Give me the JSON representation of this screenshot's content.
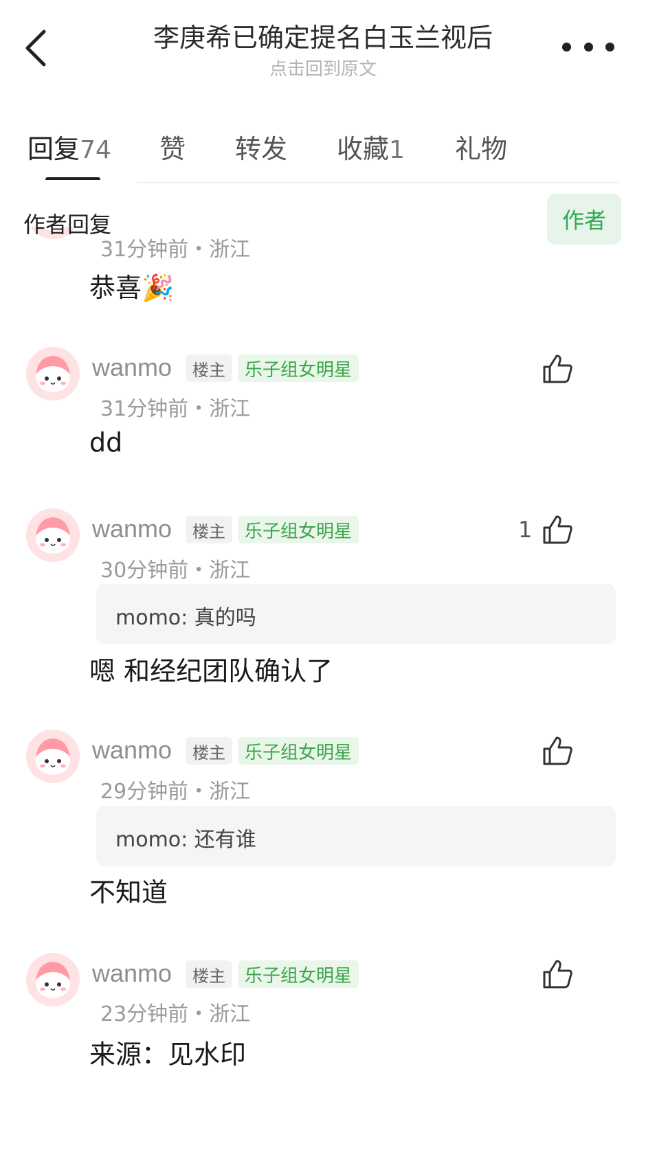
{
  "header": {
    "title": "李庚希已确定提名白玉兰视后",
    "subtitle": "点击回到原文"
  },
  "tabs": [
    {
      "label": "回复",
      "count": "74"
    },
    {
      "label": "赞",
      "count": ""
    },
    {
      "label": "转发",
      "count": ""
    },
    {
      "label": "收藏",
      "count": "1"
    },
    {
      "label": "礼物",
      "count": ""
    }
  ],
  "section": {
    "title": "作者回复",
    "author_filter": "作者"
  },
  "comments": [
    {
      "meta": "31分钟前・浙江",
      "content": "恭喜🎉"
    },
    {
      "username": "wanmo",
      "badge_host": "楼主",
      "badge_group": "乐子组女明星",
      "meta": "31分钟前・浙江",
      "content": "dd",
      "likes": ""
    },
    {
      "username": "wanmo",
      "badge_host": "楼主",
      "badge_group": "乐子组女明星",
      "meta": "30分钟前・浙江",
      "quote": "momo: 真的吗",
      "content": "嗯 和经纪团队确认了",
      "likes": "1"
    },
    {
      "username": "wanmo",
      "badge_host": "楼主",
      "badge_group": "乐子组女明星",
      "meta": "29分钟前・浙江",
      "quote": "momo: 还有谁",
      "content": "不知道",
      "likes": ""
    },
    {
      "username": "wanmo",
      "badge_host": "楼主",
      "badge_group": "乐子组女明星",
      "meta": "23分钟前・浙江",
      "content": "来源：见水印",
      "likes": ""
    }
  ],
  "colors": {
    "accent_green": "#34a853",
    "author_filter_bg": "#e6f4ea",
    "badge_green_bg": "#eaf6ea",
    "avatar_bg": "#ffe2e4"
  },
  "icons": {
    "back": "chevron-left-icon",
    "more": "more-dots-icon",
    "like": "thumb-up-icon",
    "avatar": "pink-cartoon-avatar"
  }
}
